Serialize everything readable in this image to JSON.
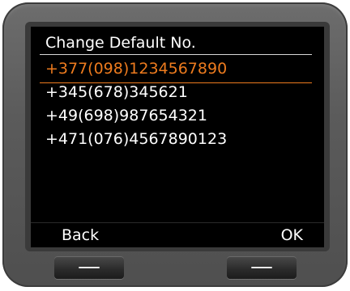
{
  "screen": {
    "title": "Change Default No.",
    "numbers": [
      "+377(098)1234567890",
      "+345(678)345621",
      "+49(698)987654321",
      "+471(076)4567890123"
    ],
    "selected_index": 0
  },
  "softkeys": {
    "left_label": "Back",
    "right_label": "OK"
  },
  "colors": {
    "screen_background": "#000000",
    "text": "#ffffff",
    "selection_accent": "#ed7b1e",
    "device_body": "#5b5b5b"
  },
  "icons": {
    "left_hardkey": "dash-icon",
    "right_hardkey": "dash-icon"
  }
}
